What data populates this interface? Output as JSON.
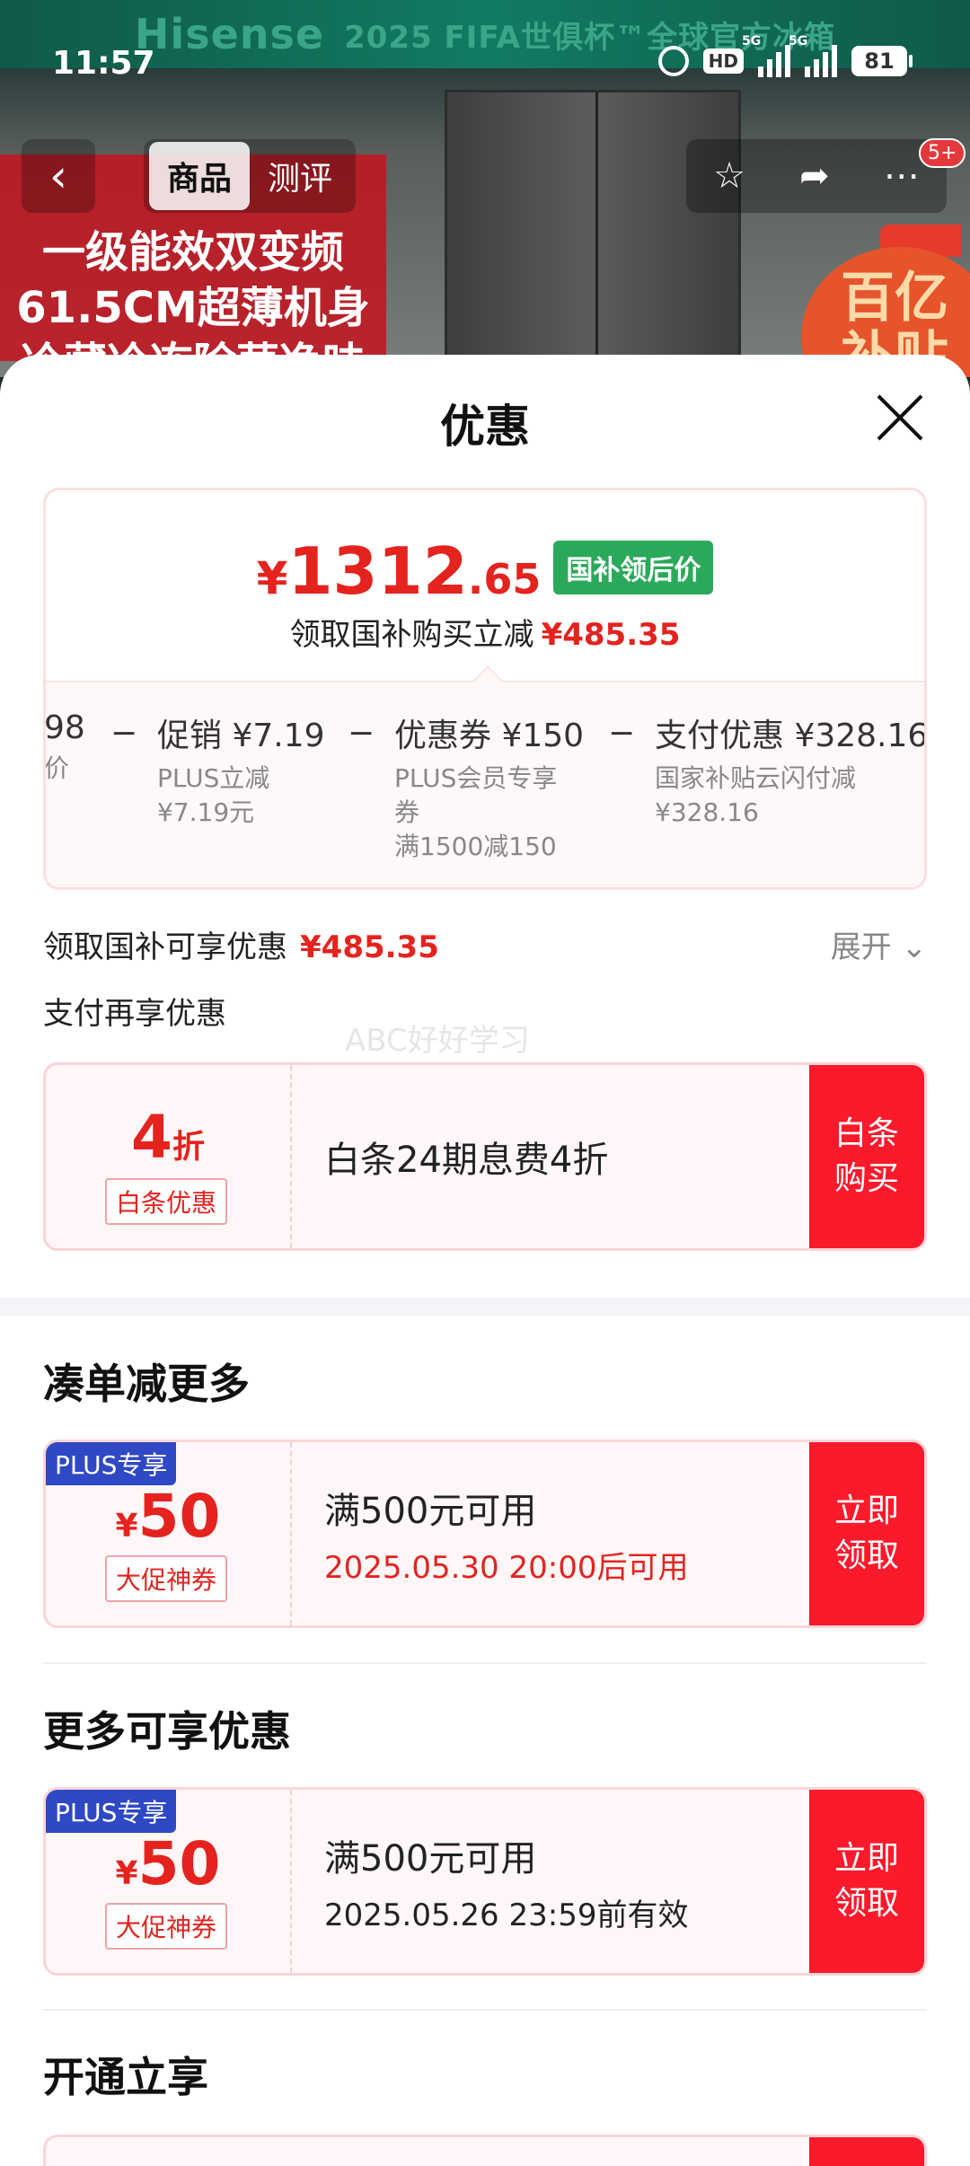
{
  "background": {
    "brand": "Hisense",
    "banner": "2025 FIFA世俱杯™全球官方冰箱",
    "promo_lines": [
      "一级能效双变频",
      "61.5CM超薄机身",
      "冷藏冷冻除菌净味"
    ],
    "subsidy_badge": "百亿补贴"
  },
  "status_bar": {
    "time": "11:57",
    "battery": "81",
    "network": "5G"
  },
  "nav": {
    "back_icon": "chevron-left-icon",
    "tabs": [
      {
        "label": "商品",
        "active": true
      },
      {
        "label": "测评",
        "active": false
      }
    ],
    "cart_badge": "5+"
  },
  "sheet": {
    "title": "优惠",
    "price": {
      "symbol": "¥",
      "integer": "1312",
      "decimal": ".65",
      "tag": "国补领后价"
    },
    "save_text": "领取国补购买立减",
    "save_amount": "¥485.35",
    "breakdown": [
      {
        "title": "98",
        "sub": [
          "价"
        ]
      },
      {
        "title": "促销 ¥7.19",
        "sub": [
          "PLUS立减",
          "¥7.19元"
        ]
      },
      {
        "title": "优惠券 ¥150",
        "sub": [
          "PLUS会员专享",
          "券",
          "满1500减150"
        ]
      },
      {
        "title": "支付优惠 ¥328.16",
        "sub": [
          "国家补贴云闪付减",
          "¥328.16"
        ]
      }
    ],
    "benefit_label": "领取国补可享优惠",
    "benefit_amount": "¥485.35",
    "expand_label": "展开",
    "pay_label": "支付再享优惠",
    "watermark": "ABC好好学习",
    "baitiao": {
      "value": "4",
      "unit": "折",
      "tag": "白条优惠",
      "desc": "白条24期息费4折",
      "button": "白条购买"
    },
    "section_more": "凑单减更多",
    "coupon1": {
      "plus_tag": "PLUS专享",
      "symbol": "¥",
      "value": "50",
      "tag": "大促神券",
      "desc": "满500元可用",
      "sub": "2025.05.30 20:00后可用",
      "button": "立即领取"
    },
    "section_extra": "更多可享优惠",
    "coupon2": {
      "plus_tag": "PLUS专享",
      "symbol": "¥",
      "value": "50",
      "tag": "大促神券",
      "desc": "满500元可用",
      "sub": "2025.05.26 23:59前有效",
      "button": "立即领取"
    },
    "section_open": "开通立享"
  },
  "colors": {
    "accent_red": "#e4231f",
    "button_red": "#fa1a2c",
    "green_tag": "#2ba95a",
    "plus_blue": "#2f48c4"
  }
}
